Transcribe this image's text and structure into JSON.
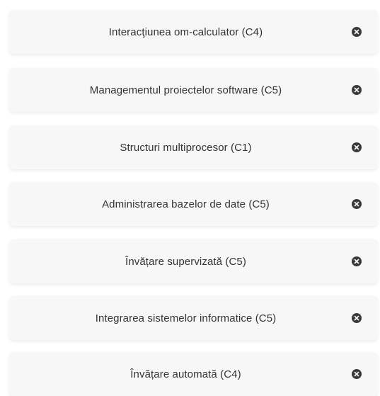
{
  "courses": [
    {
      "label": "Interacţiunea om-calculator (C4)",
      "remove_icon": "close-circle-icon"
    },
    {
      "label": "Managementul proiectelor software (C5)",
      "remove_icon": "close-circle-icon"
    },
    {
      "label": "Structuri multiprocesor (C1)",
      "remove_icon": "close-circle-icon"
    },
    {
      "label": "Administrarea bazelor de date (C5)",
      "remove_icon": "close-circle-icon"
    },
    {
      "label": "Învățare supervizată (C5)",
      "remove_icon": "close-circle-icon"
    },
    {
      "label": "Integrarea sistemelor informatice (C5)",
      "remove_icon": "close-circle-icon"
    },
    {
      "label": "Învățare automată (C4)",
      "remove_icon": "close-circle-icon"
    }
  ],
  "colors": {
    "card_background": "#f7f7f7",
    "text": "#333333",
    "remove_icon": "#3a3a3a"
  }
}
